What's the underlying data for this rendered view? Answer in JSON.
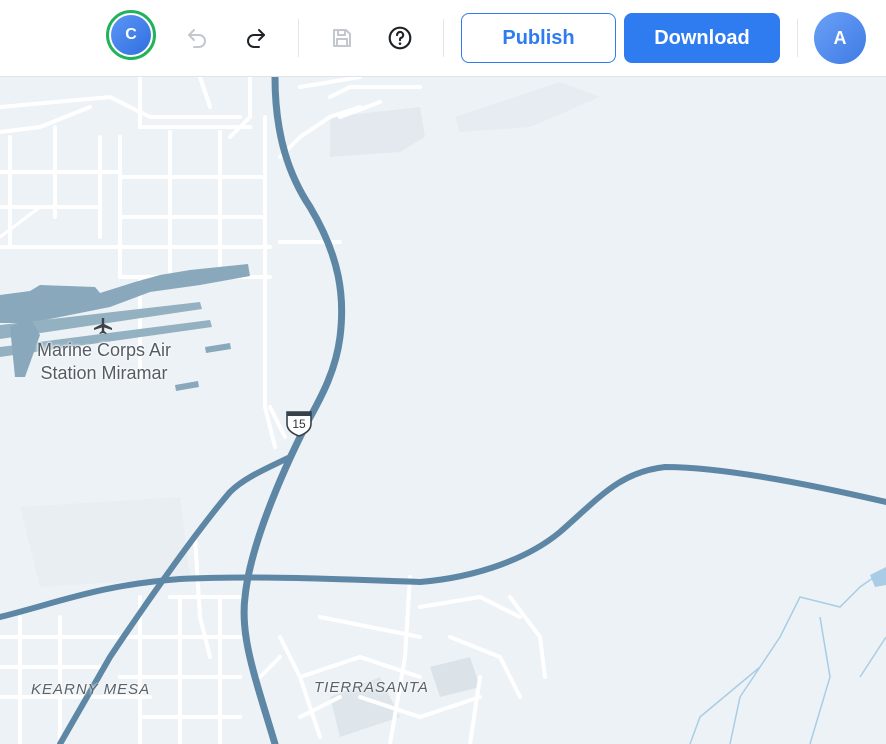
{
  "toolbar": {
    "collaborator_initial": "C",
    "user_initial": "A",
    "undo_icon": "undo-icon",
    "redo_icon": "redo-icon",
    "save_icon": "save-icon",
    "help_icon": "help-icon",
    "publish_label": "Publish",
    "download_label": "Download"
  },
  "map": {
    "place_label_line1": "Marine Corps Air",
    "place_label_line2": "Station Miramar",
    "airport_icon": "airplane-icon",
    "highway_shield": "15",
    "area_labels": [
      "KEARNY MESA",
      "TIERRASANTA"
    ]
  },
  "colors": {
    "accent": "#2f7cf0",
    "collaborator_ring": "#22b35a",
    "highway": "#5d87a5",
    "street": "#ffffff",
    "map_background": "#edf2f6",
    "airport": "#89a8bb",
    "water": "#a9cde6"
  }
}
